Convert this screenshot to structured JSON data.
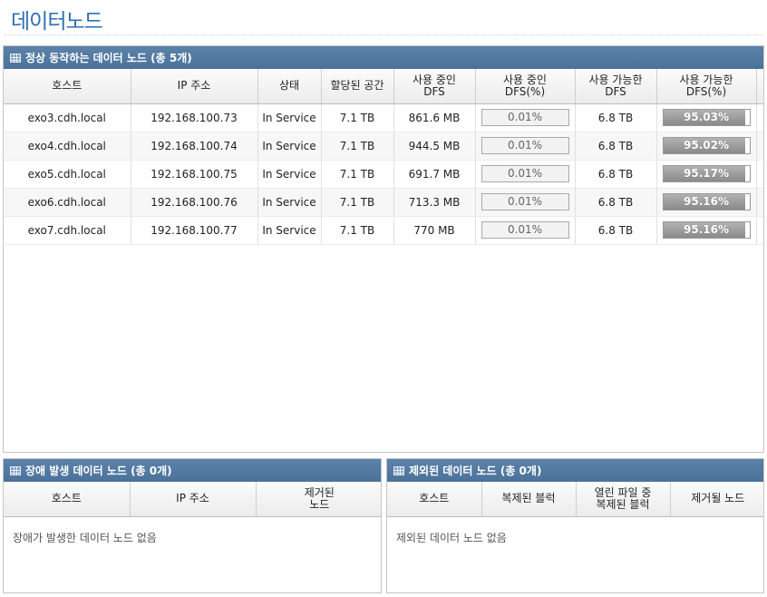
{
  "page": {
    "title": "데이터노드"
  },
  "live": {
    "header": "정상 동작하는 데이터 노드 (총 5개)",
    "columns": [
      "호스트",
      "IP 주소",
      "상태",
      "할당된 공간",
      "사용 중인\nDFS",
      "사용 중인\nDFS(%)",
      "사용 가능한\nDFS",
      "사용 가능한\nDFS(%)"
    ],
    "rows": [
      {
        "host": "exo3.cdh.local",
        "ip": "192.168.100.73",
        "state": "In Service",
        "capacity": "7.1 TB",
        "used": "861.6 MB",
        "used_pct": "0.01%",
        "used_frac": 0.0001,
        "remaining": "6.8 TB",
        "remaining_pct": "95.03%",
        "remaining_frac": 0.9503
      },
      {
        "host": "exo4.cdh.local",
        "ip": "192.168.100.74",
        "state": "In Service",
        "capacity": "7.1 TB",
        "used": "944.5 MB",
        "used_pct": "0.01%",
        "used_frac": 0.0001,
        "remaining": "6.8 TB",
        "remaining_pct": "95.02%",
        "remaining_frac": 0.9502
      },
      {
        "host": "exo5.cdh.local",
        "ip": "192.168.100.75",
        "state": "In Service",
        "capacity": "7.1 TB",
        "used": "691.7 MB",
        "used_pct": "0.01%",
        "used_frac": 0.0001,
        "remaining": "6.8 TB",
        "remaining_pct": "95.17%",
        "remaining_frac": 0.9517
      },
      {
        "host": "exo6.cdh.local",
        "ip": "192.168.100.76",
        "state": "In Service",
        "capacity": "7.1 TB",
        "used": "713.3 MB",
        "used_pct": "0.01%",
        "used_frac": 0.0001,
        "remaining": "6.8 TB",
        "remaining_pct": "95.16%",
        "remaining_frac": 0.9516
      },
      {
        "host": "exo7.cdh.local",
        "ip": "192.168.100.77",
        "state": "In Service",
        "capacity": "7.1 TB",
        "used": "770 MB",
        "used_pct": "0.01%",
        "used_frac": 0.0001,
        "remaining": "6.8 TB",
        "remaining_pct": "95.16%",
        "remaining_frac": 0.9516
      }
    ]
  },
  "dead": {
    "header": "장애 발생 데이터 노드 (총 0개)",
    "columns": [
      "호스트",
      "IP 주소",
      "제거된\n노드"
    ],
    "empty": "장애가 발생한 데이터 노드 없음"
  },
  "decom": {
    "header": "제외된 데이터 노드 (총 0개)",
    "columns": [
      "호스트",
      "복제된 블럭",
      "열린 파일 중\n복제된 블럭",
      "제거될 노드"
    ],
    "empty": "제외된 데이터 노드 없음"
  },
  "colors": {
    "title": "#2f6fb0",
    "header_bg": "#4f769e"
  },
  "icons": {
    "panel": "grid-table-icon"
  }
}
